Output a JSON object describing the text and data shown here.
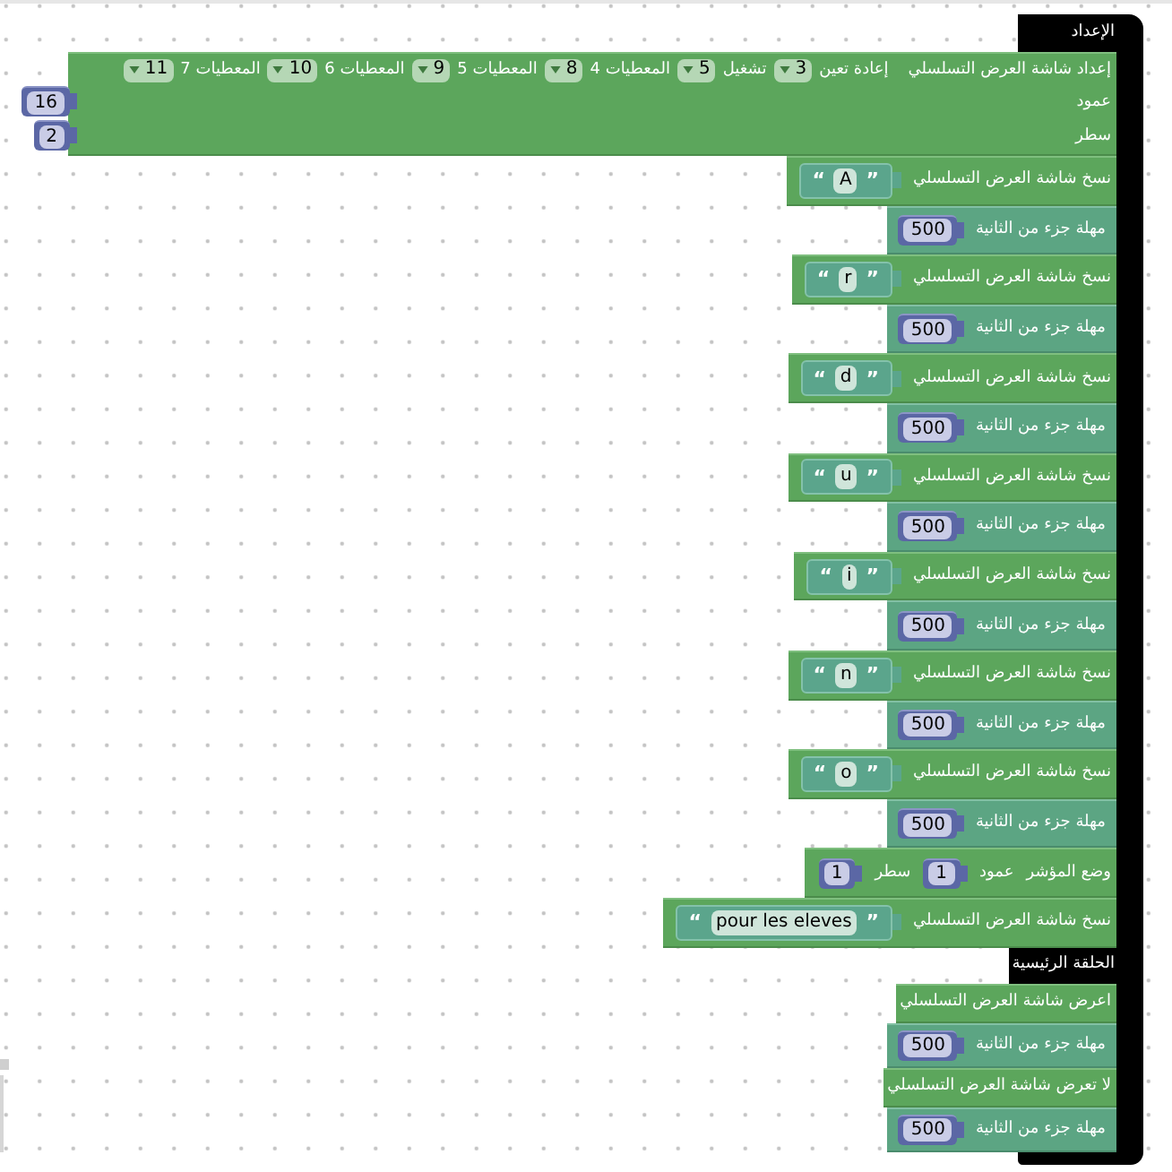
{
  "setup": {
    "label": "الإعداد",
    "blocks": [
      {
        "kind": "lcd_setup",
        "label": "إعداد شاشة العرض التسلسلي",
        "pins": [
          {
            "label": "إعادة تعين",
            "value": "3"
          },
          {
            "label": "تشغيل",
            "value": "5"
          },
          {
            "label": "المعطيات 4",
            "value": "8"
          },
          {
            "label": "المعطيات 5",
            "value": "9"
          },
          {
            "label": "المعطيات 6",
            "value": "10"
          },
          {
            "label": "المعطيات 7",
            "value": "11"
          }
        ],
        "inputs": [
          {
            "label": "عمود",
            "value": "16"
          },
          {
            "label": "سطر",
            "value": "2"
          }
        ]
      },
      {
        "kind": "print",
        "label": "نسخ شاشة العرض التسلسلي",
        "value": {
          "open_quote": "“",
          "text": "A",
          "close_quote": "”"
        }
      },
      {
        "kind": "delay",
        "label": "مهلة جزء من الثانية",
        "value": "500"
      },
      {
        "kind": "print",
        "label": "نسخ شاشة العرض التسلسلي",
        "value": {
          "open_quote": "“",
          "text": "r",
          "close_quote": "”"
        }
      },
      {
        "kind": "delay",
        "label": "مهلة جزء من الثانية",
        "value": "500"
      },
      {
        "kind": "print",
        "label": "نسخ شاشة العرض التسلسلي",
        "value": {
          "open_quote": "“",
          "text": "d",
          "close_quote": "”"
        }
      },
      {
        "kind": "delay",
        "label": "مهلة جزء من الثانية",
        "value": "500"
      },
      {
        "kind": "print",
        "label": "نسخ شاشة العرض التسلسلي",
        "value": {
          "open_quote": "“",
          "text": "u",
          "close_quote": "”"
        }
      },
      {
        "kind": "delay",
        "label": "مهلة جزء من الثانية",
        "value": "500"
      },
      {
        "kind": "print",
        "label": "نسخ شاشة العرض التسلسلي",
        "value": {
          "open_quote": "“",
          "text": "i",
          "close_quote": "”"
        }
      },
      {
        "kind": "delay",
        "label": "مهلة جزء من الثانية",
        "value": "500"
      },
      {
        "kind": "print",
        "label": "نسخ شاشة العرض التسلسلي",
        "value": {
          "open_quote": "“",
          "text": "n",
          "close_quote": "”"
        }
      },
      {
        "kind": "delay",
        "label": "مهلة جزء من الثانية",
        "value": "500"
      },
      {
        "kind": "print",
        "label": "نسخ شاشة العرض التسلسلي",
        "value": {
          "open_quote": "“",
          "text": "o",
          "close_quote": "”"
        }
      },
      {
        "kind": "delay",
        "label": "مهلة جزء من الثانية",
        "value": "500"
      },
      {
        "kind": "set_cursor",
        "label": "وضع المؤشر",
        "inputs": [
          {
            "label": "عمود",
            "value": "1"
          },
          {
            "label": "سطر",
            "value": "1"
          }
        ]
      },
      {
        "kind": "print",
        "label": "نسخ شاشة العرض التسلسلي",
        "value": {
          "open_quote": "“",
          "text": "pour les eleves",
          "close_quote": "”"
        }
      }
    ]
  },
  "loop": {
    "label": "الحلقة الرئيسية",
    "blocks": [
      {
        "kind": "display",
        "label": "اعرض شاشة العرض التسلسلي"
      },
      {
        "kind": "delay",
        "label": "مهلة جزء من الثانية",
        "value": "500"
      },
      {
        "kind": "no_display",
        "label": "لا تعرض شاشة العرض التسلسلي"
      },
      {
        "kind": "delay",
        "label": "مهلة جزء من الثانية",
        "value": "500"
      }
    ]
  }
}
